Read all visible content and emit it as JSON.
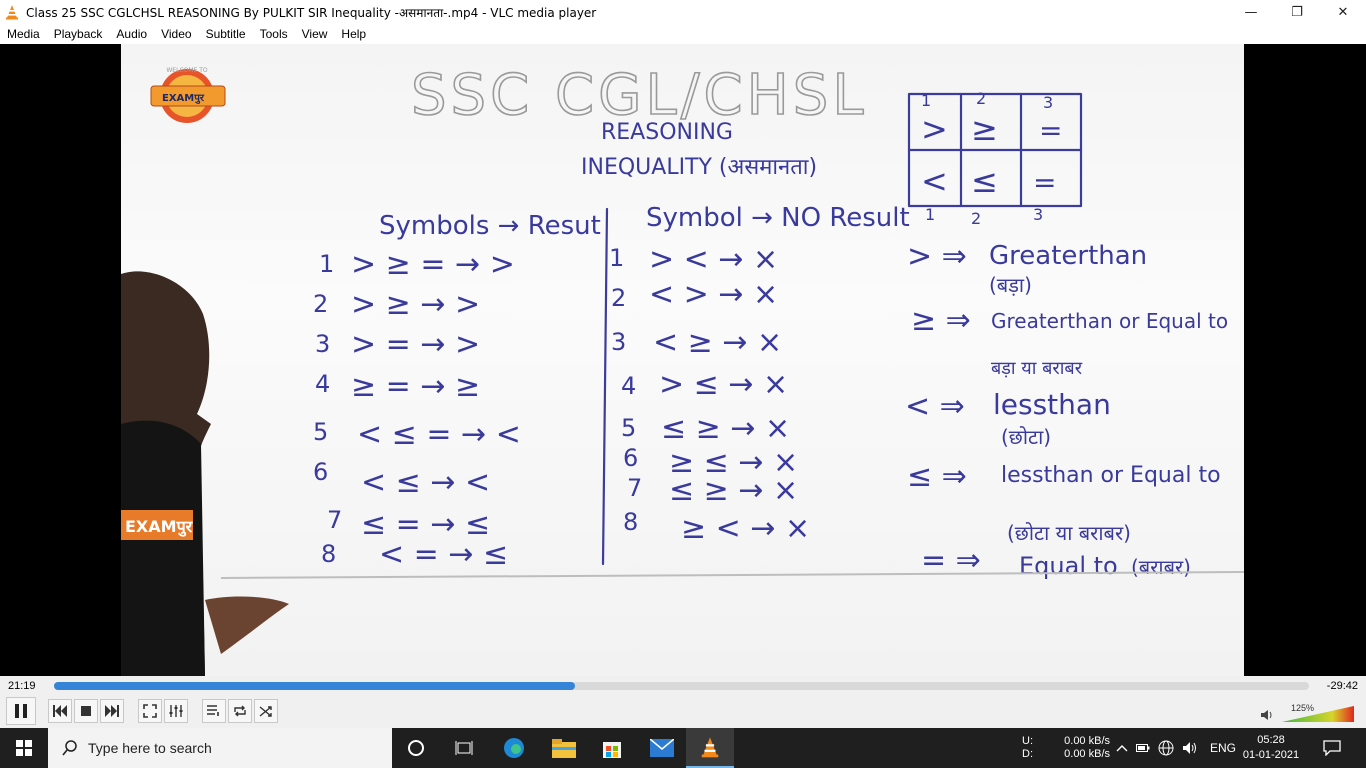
{
  "window": {
    "title": "Class 25 SSC CGLCHSL REASONING By PULKIT SIR Inequality -असमानता-.mp4 - VLC media player",
    "minimize_glyph": "—",
    "restore_glyph": "❐",
    "close_glyph": "✕"
  },
  "menu": [
    "Media",
    "Playback",
    "Audio",
    "Video",
    "Subtitle",
    "Tools",
    "View",
    "Help"
  ],
  "video": {
    "logo_top": "WELCOME TO",
    "logo_main": "EXAMपुर",
    "shirt_logo": "EXAMपुर",
    "board": {
      "heading": "SSC CGL/CHSL",
      "sub1": "REASONING",
      "sub2": "INEQUALITY (असमानता)",
      "col1_header": "Symbols → Resut",
      "col2_header": "Symbol → NO Result",
      "col1_rows": [
        {
          "n": "1",
          "expr": "> ≥ =  →  >"
        },
        {
          "n": "2",
          "expr": "> ≥     →  >"
        },
        {
          "n": "3",
          "expr": ">    = →  >"
        },
        {
          "n": "4",
          "expr": "    ≥ = → ≥"
        },
        {
          "n": "5",
          "expr": "< ≤ = → <"
        },
        {
          "n": "6",
          "expr": "< ≤     → <"
        },
        {
          "n": "7",
          "expr": "    ≤ = → ≤"
        },
        {
          "n": "8",
          "expr": "<    = → ≤"
        }
      ],
      "col2_rows": [
        {
          "n": "1",
          "expr": "> <  →  ×"
        },
        {
          "n": "2",
          "expr": "< >  →  ×"
        },
        {
          "n": "3",
          "expr": "< ≥  →  ×"
        },
        {
          "n": "4",
          "expr": "> ≤  →  ×"
        },
        {
          "n": "5",
          "expr": "≤ ≥  →  ×"
        },
        {
          "n": "6",
          "expr": "≥ ≤  → ×"
        },
        {
          "n": "7",
          "expr": "≤ ≥  → ×"
        },
        {
          "n": "8",
          "expr": "≥ <  → ×"
        }
      ],
      "grid_top_nums": [
        "1",
        "2",
        "3"
      ],
      "grid_row1": [
        ">",
        "≥",
        "="
      ],
      "grid_row2": [
        "<",
        "≤",
        "="
      ],
      "grid_bottom_nums": [
        "1",
        "2",
        "3"
      ],
      "legend": [
        {
          "sym": "> ⇒",
          "text": "Greaterthan",
          "hindi": "(बड़ा)"
        },
        {
          "sym": "≥ ⇒",
          "text": "Greaterthan or Equal to",
          "hindi": "बड़ा या बराबर"
        },
        {
          "sym": "< ⇒",
          "text": "lessthan",
          "hindi": "(छोटा)"
        },
        {
          "sym": "≤ ⇒",
          "text": "lessthan or Equal to",
          "hindi": "(छोटा या बराबर)"
        },
        {
          "sym": "= ⇒",
          "text": "Equal to",
          "hindi": "(बराबर)"
        }
      ]
    }
  },
  "controls": {
    "elapsed": "21:19",
    "remaining": "-29:42",
    "progress": 0.415,
    "volume_label": "125%",
    "volume_level": 1.0
  },
  "taskbar": {
    "search_placeholder": "Type here to search",
    "net_up_label": "U:",
    "net_down_label": "D:",
    "net_up": "0.00 kB/s",
    "net_down": "0.00 kB/s",
    "language": "ENG",
    "time": "05:28",
    "date": "01-01-2021"
  }
}
